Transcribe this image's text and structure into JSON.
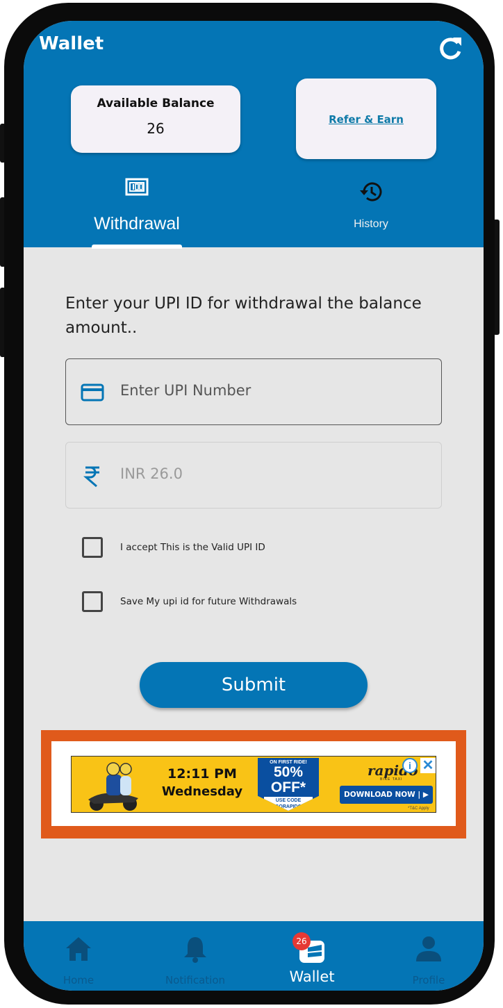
{
  "header": {
    "title": "Wallet",
    "refresh_icon": "refresh-icon"
  },
  "balance_card": {
    "label": "Available Balance",
    "value": "26"
  },
  "refer_card": {
    "link_label": "Refer & Earn"
  },
  "tabs": [
    {
      "label": "Withdrawal",
      "icon": "cash-icon",
      "selected": true
    },
    {
      "label": "History",
      "icon": "history-icon",
      "selected": false
    }
  ],
  "form": {
    "prompt": "Enter your UPI ID for withdrawal the balance amount..",
    "upi_field": {
      "placeholder": "Enter UPI Number",
      "icon": "card-icon"
    },
    "amount_field": {
      "value": "INR 26.0",
      "icon": "rupee-icon"
    },
    "checkboxes": [
      {
        "label": "I accept This is the Valid UPI ID",
        "checked": false
      },
      {
        "label": "Save My upi id for future Withdrawals",
        "checked": false
      }
    ],
    "submit_label": "Submit"
  },
  "ad": {
    "time": "12:11 PM",
    "day": "Wednesday",
    "offer_top": "ON FIRST RIDE!",
    "offer_main": "50% OFF*",
    "offer_code": "USE CODE GORAPIDO",
    "brand": "rapido",
    "brand_sub": "BIKE TAXI",
    "cta": "DOWNLOAD NOW | ▶",
    "terms": "*T&C Apply",
    "info_icon": "info-icon",
    "close_icon": "close-icon"
  },
  "bottom_nav": {
    "items": [
      {
        "label": "Home",
        "icon": "home-icon",
        "active": false
      },
      {
        "label": "Notification",
        "icon": "bell-icon",
        "active": false
      },
      {
        "label": "Wallet",
        "icon": "wallet-icon",
        "active": true,
        "badge": "26"
      },
      {
        "label": "Profile",
        "icon": "person-icon",
        "active": false
      }
    ]
  },
  "colors": {
    "primary": "#0475b5",
    "background": "#e6e6e6",
    "ad_border": "#e05a1b",
    "badge": "#e53935"
  }
}
